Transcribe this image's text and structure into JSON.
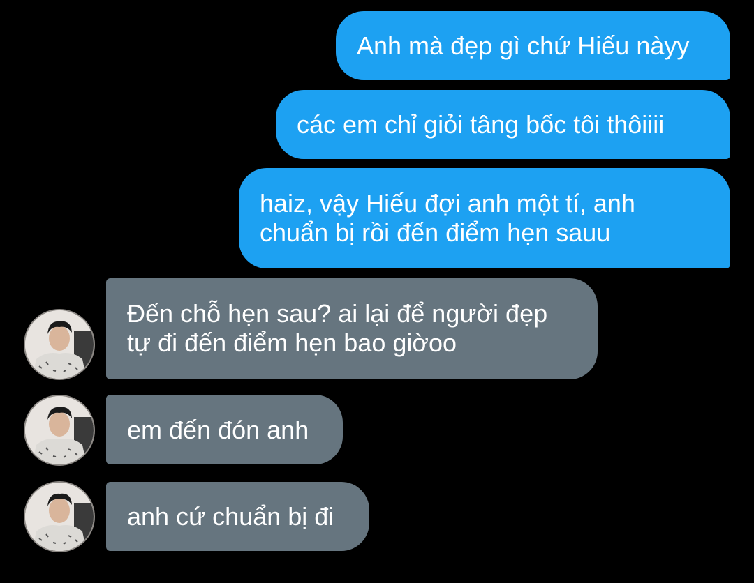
{
  "colors": {
    "background": "#000000",
    "sent_bubble": "#1da1f2",
    "received_bubble": "#66757f",
    "text": "#ffffff"
  },
  "messages": [
    {
      "direction": "sent",
      "text": "Anh mà đẹp gì chứ Hiếu nàyy"
    },
    {
      "direction": "sent",
      "text": "các em chỉ giỏi tâng bốc tôi thôiiii"
    },
    {
      "direction": "sent",
      "text": "haiz, vậy Hiếu đợi anh một tí, anh\nchuẩn bị rồi đến điểm hẹn sauu"
    },
    {
      "direction": "received",
      "text": "Đến chỗ hẹn sau? ai lại để người đẹp\ntự đi đến điểm hẹn bao giờoo",
      "avatar": "user-avatar"
    },
    {
      "direction": "received",
      "text": "em đến đón anh",
      "avatar": "user-avatar"
    },
    {
      "direction": "received",
      "text": "anh cứ chuẩn bị đi",
      "avatar": "user-avatar"
    }
  ]
}
